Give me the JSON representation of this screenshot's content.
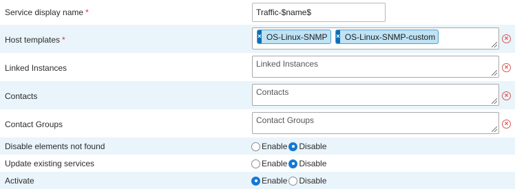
{
  "rows": {
    "service_display_name": {
      "label": "Service display name",
      "required": "*",
      "value": "Traffic-$name$"
    },
    "host_templates": {
      "label": "Host templates",
      "required": "*",
      "chips": [
        "OS-Linux-SNMP",
        "OS-Linux-SNMP-custom"
      ],
      "chip_remove": "×",
      "clear": "×"
    },
    "linked_instances": {
      "label": "Linked Instances",
      "placeholder": "Linked Instances",
      "clear": "×"
    },
    "contacts": {
      "label": "Contacts",
      "placeholder": "Contacts",
      "clear": "×"
    },
    "contact_groups": {
      "label": "Contact Groups",
      "placeholder": "Contact Groups",
      "clear": "×"
    },
    "disable_not_found": {
      "label": "Disable elements not found",
      "option1": "Enable",
      "option2": "Disable",
      "selected": "Disable"
    },
    "update_existing": {
      "label": "Update existing services",
      "option1": "Enable",
      "option2": "Disable",
      "selected": "Disable"
    },
    "activate": {
      "label": "Activate",
      "option1": "Enable",
      "option2": "Disable",
      "selected": "Enable"
    }
  },
  "colors": {
    "row_alt": "#eaf4fb",
    "required": "#e0245e",
    "chip_bg": "#bfe3f5",
    "chip_x": "#0a6fb5",
    "clear": "#d9534f",
    "radio_on": "#1479d4"
  }
}
